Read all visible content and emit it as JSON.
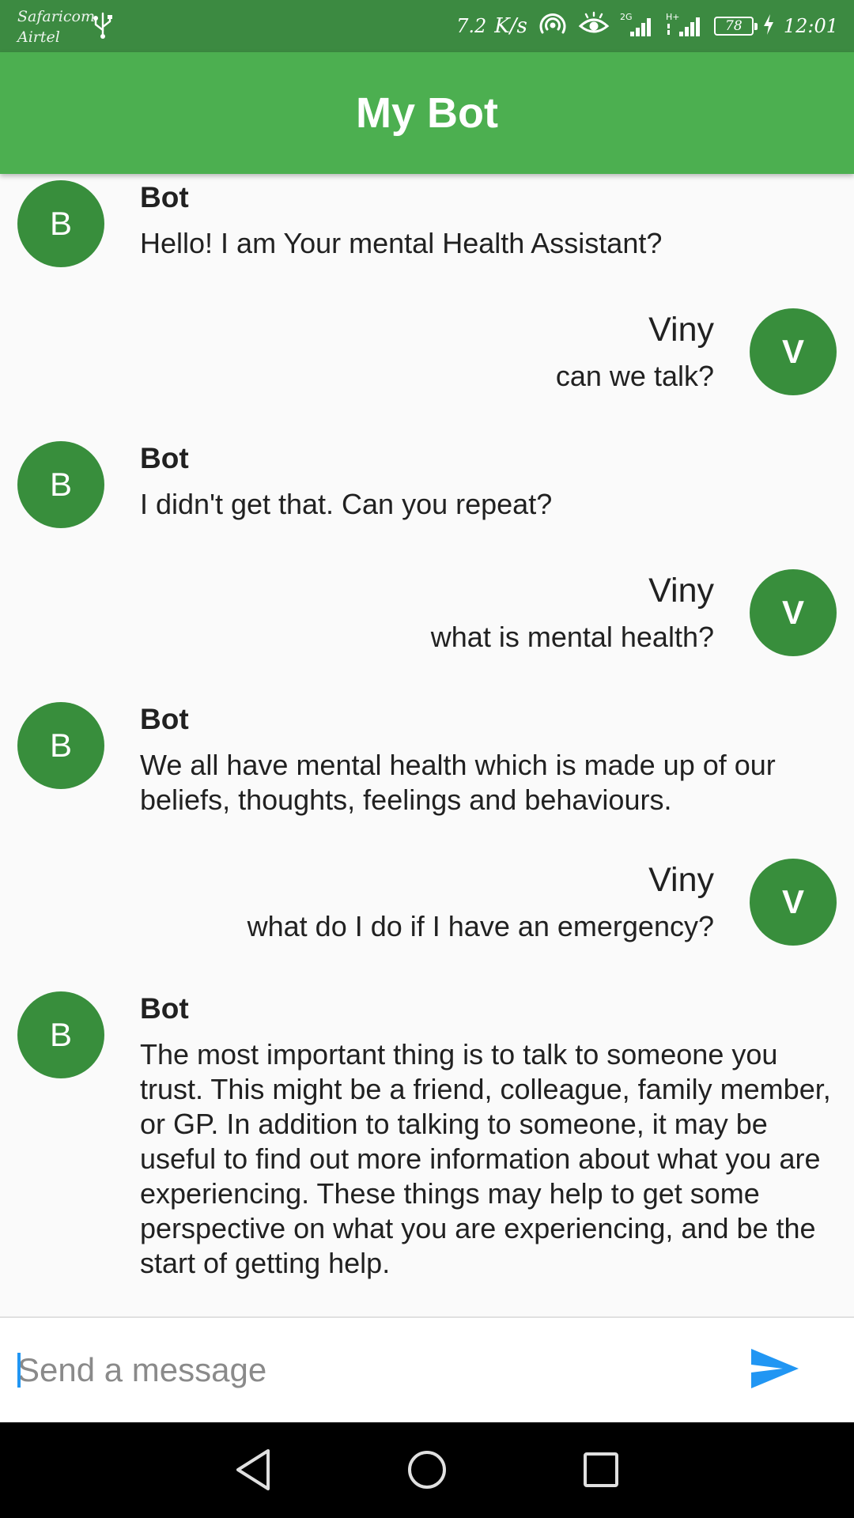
{
  "status_bar": {
    "carrier_1": "Safaricom",
    "carrier_2": "Airtel",
    "speed_value": "7.2",
    "speed_unit": "K/s",
    "network_1": "2G",
    "network_2": "H+",
    "battery": "78",
    "time": "12:01"
  },
  "app_bar": {
    "title": "My Bot"
  },
  "messages": [
    {
      "sender": "bot",
      "avatar": "B",
      "name": "Bot",
      "text": "Hello! I am Your mental Health Assistant?"
    },
    {
      "sender": "user",
      "avatar": "V",
      "name": "Viny",
      "text": "can we talk?"
    },
    {
      "sender": "bot",
      "avatar": "B",
      "name": "Bot",
      "text": "I didn't get that. Can you repeat?"
    },
    {
      "sender": "user",
      "avatar": "V",
      "name": "Viny",
      "text": "what is mental health?"
    },
    {
      "sender": "bot",
      "avatar": "B",
      "name": "Bot",
      "text": "We all have mental health which is made up of our beliefs, thoughts, feelings and behaviours."
    },
    {
      "sender": "user",
      "avatar": "V",
      "name": "Viny",
      "text": "what do I do if I have an emergency?"
    },
    {
      "sender": "bot",
      "avatar": "B",
      "name": "Bot",
      "text": "The most important thing is to talk to someone you trust. This might be a friend, colleague, family member, or GP. In addition to talking to someone, it may be useful to find out more information about what you are experiencing. These things may help to get some perspective on what you are experiencing, and be the start of getting help."
    }
  ],
  "composer": {
    "value": "",
    "placeholder": "Send a message",
    "send_icon": "send-icon"
  },
  "nav_bar": {
    "back_icon": "back-triangle-icon",
    "home_icon": "home-circle-icon",
    "recents_icon": "recents-square-icon"
  },
  "colors": {
    "status_bar": "#3c8a41",
    "app_bar": "#4caf50",
    "avatar": "#388e3c",
    "send": "#2196f3",
    "background": "#fafafa"
  }
}
